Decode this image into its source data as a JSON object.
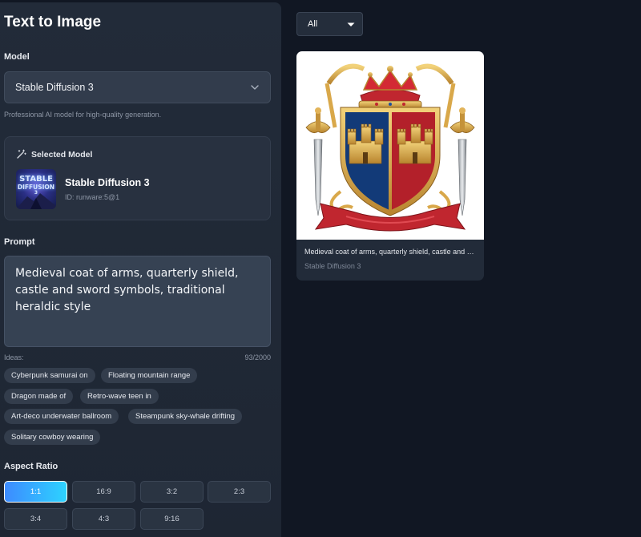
{
  "panel": {
    "title": "Text to Image",
    "model_label": "Model",
    "model_value": "Stable Diffusion 3",
    "model_description": "Professional AI model for high-quality generation.",
    "selected_model": {
      "heading": "Selected Model",
      "name": "Stable Diffusion 3",
      "id": "ID: runware:5@1",
      "thumb_line1": "STABLE",
      "thumb_line2": "DIFFUSION",
      "thumb_line3": "3"
    },
    "prompt_label": "Prompt",
    "prompt_text": "Medieval coat of arms, quarterly shield, castle and sword symbols, traditional heraldic style",
    "ideas_label": "Ideas:",
    "char_count": "93/2000",
    "ideas": [
      "Cyberpunk samurai on",
      "Floating mountain range",
      "Dragon made of",
      "Retro-wave teen in",
      "Art-deco underwater ballroom",
      "Steampunk sky-whale drifting",
      "Solitary cowboy wearing"
    ],
    "aspect_label": "Aspect Ratio",
    "aspect_ratios": [
      "1:1",
      "16:9",
      "3:2",
      "2:3",
      "3:4",
      "4:3",
      "9:16"
    ],
    "aspect_selected": "1:1"
  },
  "gallery": {
    "filter_value": "All",
    "cards": [
      {
        "caption": "Medieval coat of arms, quarterly shield, castle and sword symbols, traditional heraldic style",
        "model": "Stable Diffusion 3"
      }
    ]
  },
  "colors": {
    "background": "#111723",
    "panel": "#222b39",
    "accent_start": "#3d8bff",
    "accent_end": "#2dd3ff",
    "shield_blue": "#123a78",
    "shield_red": "#b3202a",
    "gold": "#d9a84a"
  },
  "icons": {
    "select_chevron": "chevron-down-icon",
    "selected_model": "magic-wand-icon"
  }
}
